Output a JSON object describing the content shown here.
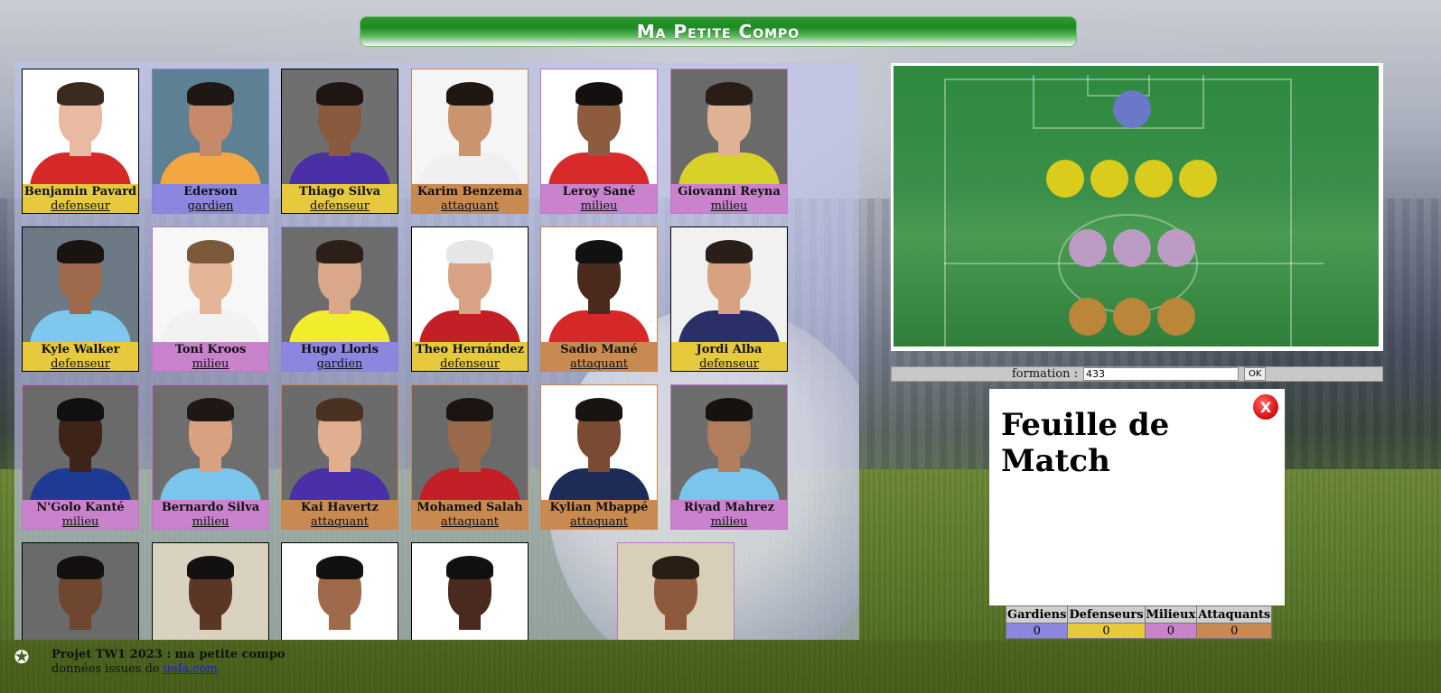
{
  "title": "Ma Petite Compo",
  "players": [
    {
      "name": "Benjamin Pavard",
      "role": "defenseur",
      "cls": "def",
      "bg": "#ffffff",
      "shirt": "#d62828",
      "skin": "#e9b9a2",
      "hair": "#3a2a20"
    },
    {
      "name": "Ederson",
      "role": "gardien",
      "cls": "gk",
      "bg": "#5d8193",
      "shirt": "#f4a640",
      "skin": "#c68a6a",
      "hair": "#1d1815"
    },
    {
      "name": "Thiago Silva",
      "role": "defenseur",
      "cls": "def",
      "bg": "#6f6f6f",
      "shirt": "#4a2fa8",
      "skin": "#8a5a3e",
      "hair": "#1d1612"
    },
    {
      "name": "Karim Benzema",
      "role": "attaquant",
      "cls": "att",
      "bg": "#f5f5f5",
      "shirt": "#f0f0f2",
      "skin": "#c9946e",
      "hair": "#1e1712"
    },
    {
      "name": "Leroy Sané",
      "role": "milieu",
      "cls": "mid",
      "bg": "#ffffff",
      "shirt": "#d82a2a",
      "skin": "#8d5c3f",
      "hair": "#151010"
    },
    {
      "name": "Giovanni Reyna",
      "role": "milieu",
      "cls": "mid",
      "bg": "#6a6a6a",
      "shirt": "#d8d12a",
      "skin": "#e0b295",
      "hair": "#2a1d15"
    },
    {
      "name": "Kyle Walker",
      "role": "defenseur",
      "cls": "def",
      "bg": "#6d7a86",
      "shirt": "#7ec8ef",
      "skin": "#9e6a4c",
      "hair": "#1a1410"
    },
    {
      "name": "Toni Kroos",
      "role": "milieu",
      "cls": "mid",
      "bg": "#f7f7f7",
      "shirt": "#f2f2f2",
      "skin": "#e4b596",
      "hair": "#7a5a3a"
    },
    {
      "name": "Hugo Lloris",
      "role": "gardien",
      "cls": "gk",
      "bg": "#6c6c6c",
      "shirt": "#f1ec2c",
      "skin": "#d9a88a",
      "hair": "#2c1f17"
    },
    {
      "name": "Theo Hernández",
      "role": "defenseur",
      "cls": "def",
      "bg": "#ffffff",
      "shirt": "#c21f26",
      "skin": "#d8a384",
      "hair": "#e6e6e6"
    },
    {
      "name": "Sadio Mané",
      "role": "attaquant",
      "cls": "att",
      "bg": "#ffffff",
      "shirt": "#d62828",
      "skin": "#4a2a1c",
      "hair": "#111111"
    },
    {
      "name": "Jordi Alba",
      "role": "defenseur",
      "cls": "def",
      "bg": "#f1f1f1",
      "shirt": "#2a2f68",
      "skin": "#d6a282",
      "hair": "#2a1f18"
    },
    {
      "name": "N'Golo Kanté",
      "role": "milieu",
      "cls": "mid",
      "bg": "#6a6a6a",
      "shirt": "#1f3a93",
      "skin": "#3e2318",
      "hair": "#111111"
    },
    {
      "name": "Bernardo Silva",
      "role": "milieu",
      "cls": "mid",
      "bg": "#6e6e6e",
      "shirt": "#79c5ec",
      "skin": "#d8a281",
      "hair": "#1f1713"
    },
    {
      "name": "Kai Havertz",
      "role": "attaquant",
      "cls": "att",
      "bg": "#6b6b6b",
      "shirt": "#4a2fa8",
      "skin": "#e1ae8f",
      "hair": "#4a3222"
    },
    {
      "name": "Mohamed Salah",
      "role": "attaquant",
      "cls": "att",
      "bg": "#6a6a6a",
      "shirt": "#c21f26",
      "skin": "#9a6a4a",
      "hair": "#1b1410"
    },
    {
      "name": "Kylian Mbappé",
      "role": "attaquant",
      "cls": "att",
      "bg": "#ffffff",
      "shirt": "#1c2c56",
      "skin": "#7a4a32",
      "hair": "#1a1410"
    },
    {
      "name": "Riyad Mahrez",
      "role": "milieu",
      "cls": "mid",
      "bg": "#6d6d6d",
      "shirt": "#79c5ec",
      "skin": "#b07e5c",
      "hair": "#161210"
    },
    {
      "name": "",
      "role": "",
      "cls": "def",
      "bg": "#6a6a6a",
      "shirt": "#6a6a6a",
      "skin": "#6f4630",
      "hair": "#151010"
    },
    {
      "name": "",
      "role": "",
      "cls": "def",
      "bg": "#d9d2c0",
      "shirt": "#d9d2c0",
      "skin": "#5a3624",
      "hair": "#121010"
    },
    {
      "name": "",
      "role": "",
      "cls": "def",
      "bg": "#ffffff",
      "shirt": "#ffffff",
      "skin": "#9e6a4a",
      "hair": "#121010"
    },
    {
      "name": "",
      "role": "",
      "cls": "def",
      "bg": "#ffffff",
      "shirt": "#ffffff",
      "skin": "#4a2a1e",
      "hair": "#121010"
    },
    {
      "name": "",
      "role": "",
      "cls": "mid",
      "bg": "#d8cfb8",
      "shirt": "#d8cfb8",
      "skin": "#8e5a3c",
      "hair": "#2a1d15"
    }
  ],
  "formation": {
    "label": "formation :",
    "value": "433",
    "ok_label": "OK"
  },
  "feuille": {
    "title": "Feuille de Match",
    "close_label": "X"
  },
  "stats": {
    "headers": [
      "Gardiens",
      "Defenseurs",
      "Milieux",
      "Attaquants"
    ],
    "values": [
      "0",
      "0",
      "0",
      "0"
    ],
    "colors": [
      "#8d86df",
      "#e6c93c",
      "#c983cc",
      "#c98a52"
    ]
  },
  "footer": {
    "line1": "Projet TW1 2023 : ma petite compo",
    "line2_prefix": "données issues de",
    "link_text": "uefa.com",
    "logo_text": "CHAMPIONS LEAGUE"
  },
  "colors": {
    "defenseur": "#e6c93c",
    "gardien": "#8d86df",
    "milieu": "#c983cc",
    "attaquant": "#c98a52"
  }
}
